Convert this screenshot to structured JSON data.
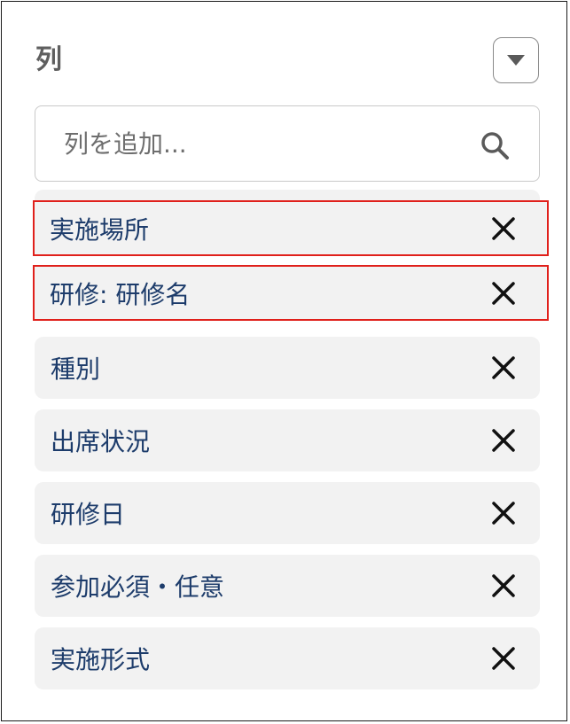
{
  "panel": {
    "title": "列",
    "menu_icon": "caret-down-icon"
  },
  "search": {
    "placeholder": "列を追加...",
    "value": "",
    "icon": "search-icon"
  },
  "columns": [
    {
      "label": "実施場所",
      "highlighted": true
    },
    {
      "label": "研修: 研修名",
      "highlighted": true
    },
    {
      "label": "種別",
      "highlighted": false
    },
    {
      "label": "出席状況",
      "highlighted": false
    },
    {
      "label": "研修日",
      "highlighted": false
    },
    {
      "label": "参加必須・任意",
      "highlighted": false
    },
    {
      "label": "実施形式",
      "highlighted": false
    }
  ],
  "colors": {
    "label": "#1d3c6b",
    "item_bg": "#f2f2f2",
    "highlight_border": "#e0201b",
    "title": "#5f5f5f"
  }
}
